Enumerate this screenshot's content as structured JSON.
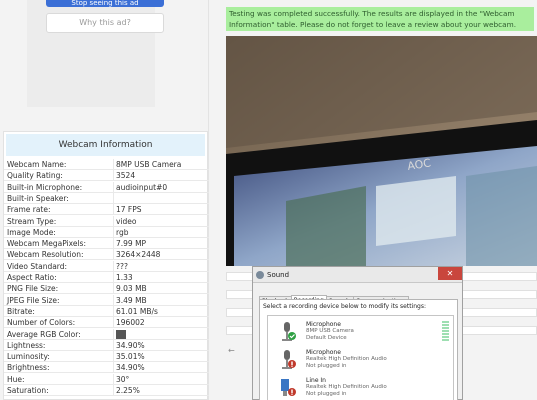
{
  "ad": {
    "stop_button_label": "Stop seeing this ad",
    "why_button_label": "Why this ad?"
  },
  "webcam_info": {
    "title": "Webcam Information",
    "rows": [
      {
        "label": "Webcam Name:",
        "value": "8MP USB Camera"
      },
      {
        "label": "Quality Rating:",
        "value": "3524"
      },
      {
        "label": "Built-in Microphone:",
        "value": "audioinput#0"
      },
      {
        "label": "Built-in Speaker:",
        "value": ""
      },
      {
        "label": "Frame rate:",
        "value": "17 FPS"
      },
      {
        "label": "Stream Type:",
        "value": "video"
      },
      {
        "label": "Image Mode:",
        "value": "rgb"
      },
      {
        "label": "Webcam MegaPixels:",
        "value": "7.99 MP"
      },
      {
        "label": "Webcam Resolution:",
        "value": "3264×2448"
      },
      {
        "label": "Video Standard:",
        "value": "???"
      },
      {
        "label": "Aspect Ratio:",
        "value": "1.33"
      },
      {
        "label": "PNG File Size:",
        "value": "9.03 MB"
      },
      {
        "label": "JPEG File Size:",
        "value": "3.49 MB"
      },
      {
        "label": "Bitrate:",
        "value": "61.01 MB/s"
      },
      {
        "label": "Number of Colors:",
        "value": "196002"
      },
      {
        "label": "Average RGB Color:",
        "value": ""
      },
      {
        "label": "Lightness:",
        "value": "34.90%"
      },
      {
        "label": "Luminosity:",
        "value": "35.01%"
      },
      {
        "label": "Brightness:",
        "value": "34.90%"
      },
      {
        "label": "Hue:",
        "value": "30°"
      },
      {
        "label": "Saturation:",
        "value": "2.25%"
      }
    ],
    "average_rgb_color": "#555555"
  },
  "success_message": "Testing was completed successfully. The results are displayed in the \"Webcam Information\" table. Please do not forget to leave a review about your webcam.",
  "scroll_arrow": "←",
  "sound_dialog": {
    "title": "Sound",
    "close_symbol": "✕",
    "tabs": [
      "Playback",
      "Recording",
      "Sounds",
      "Communications"
    ],
    "active_tab": "Recording",
    "instruction": "Select a recording device below to modify its settings:",
    "devices": [
      {
        "name": "Microphone",
        "sub": "8MP USB Camera",
        "status": "Default Device",
        "icon": "microphone-icon"
      },
      {
        "name": "Microphone",
        "sub": "Realtek High Definition Audio",
        "status": "Not plugged in",
        "icon": "microphone-icon"
      },
      {
        "name": "Line In",
        "sub": "Realtek High Definition Audio",
        "status": "Not plugged in",
        "icon": "line-in-icon"
      }
    ]
  },
  "colors": {
    "success_bg": "#a9ee9d",
    "header_bg": "#e3f2fb",
    "ad_button": "#3b6fd6",
    "close_button": "#c9463d"
  }
}
